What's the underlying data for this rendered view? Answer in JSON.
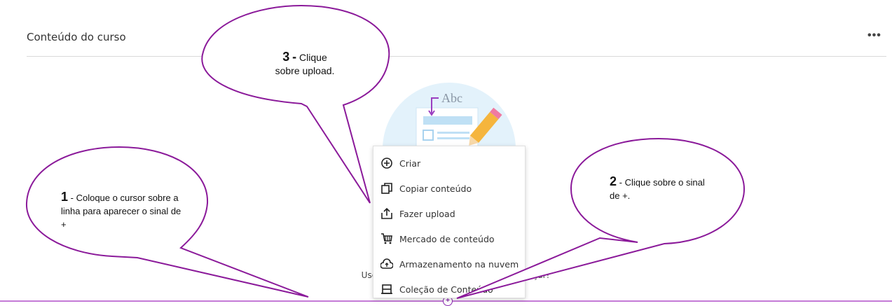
{
  "header": {
    "title": "Conteúdo do curso",
    "more_label": "•••"
  },
  "empty_state": {
    "message": "Use este espaço para ... mais para começar!"
  },
  "menu": {
    "items": [
      {
        "label": "Criar",
        "icon": "plus-circle-icon"
      },
      {
        "label": "Copiar conteúdo",
        "icon": "copy-icon"
      },
      {
        "label": "Fazer upload",
        "icon": "upload-icon"
      },
      {
        "label": "Mercado de conteúdo",
        "icon": "cart-icon"
      },
      {
        "label": "Armazenamento na nuvem",
        "icon": "cloud-icon"
      },
      {
        "label": "Coleção de Conteúdo",
        "icon": "collection-icon"
      }
    ]
  },
  "illustration": {
    "text": "Abc"
  },
  "callouts": {
    "c1_num": "1",
    "c1_text": "- Coloque o cursor sobre a linha para aparecer o sinal de +",
    "c2_num": "2",
    "c2_text": "- Clique sobre o sinal de +.",
    "c3_num": "3",
    "c3_dash": "-",
    "c3_text1": "Clique",
    "c3_text2": "sobre upload."
  },
  "plus_symbol": "+",
  "colors": {
    "accent": "#8a2ab0",
    "callout_stroke": "#8b1a9a",
    "insert_line": "#c47ad6"
  }
}
